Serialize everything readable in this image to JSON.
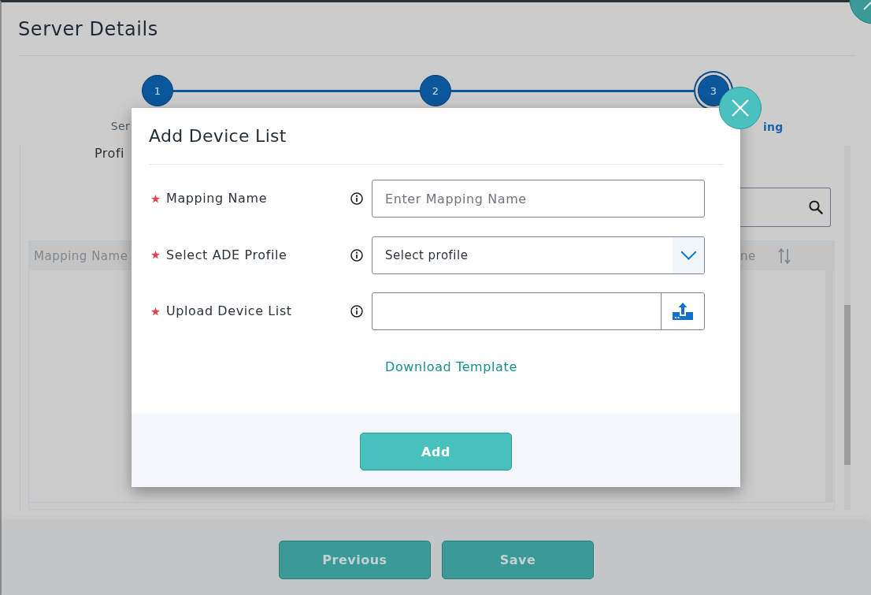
{
  "server_dialog": {
    "title": "Server Details",
    "stepper": [
      {
        "number": "1",
        "label": "Ser",
        "selected": false
      },
      {
        "number": "2",
        "selected": false
      },
      {
        "number": "3",
        "label": "ing",
        "selected": true
      }
    ],
    "section_label": "Profi",
    "table": {
      "columns": [
        {
          "label": "Mapping Name",
          "sortable": false
        },
        {
          "label": "ne",
          "sortable": true
        }
      ]
    },
    "buttons": [
      "Previous",
      "Save"
    ]
  },
  "add_device_dialog": {
    "title": "Add Device List",
    "fields": [
      {
        "kind": "text",
        "label": "Mapping Name",
        "required": true,
        "placeholder": "Enter Mapping Name"
      },
      {
        "kind": "select",
        "label": "Select ADE Profile",
        "required": true,
        "value": "Select profile"
      },
      {
        "kind": "file",
        "label": "Upload Device List",
        "required": true
      }
    ],
    "link": "Download Template",
    "button": "Add"
  }
}
